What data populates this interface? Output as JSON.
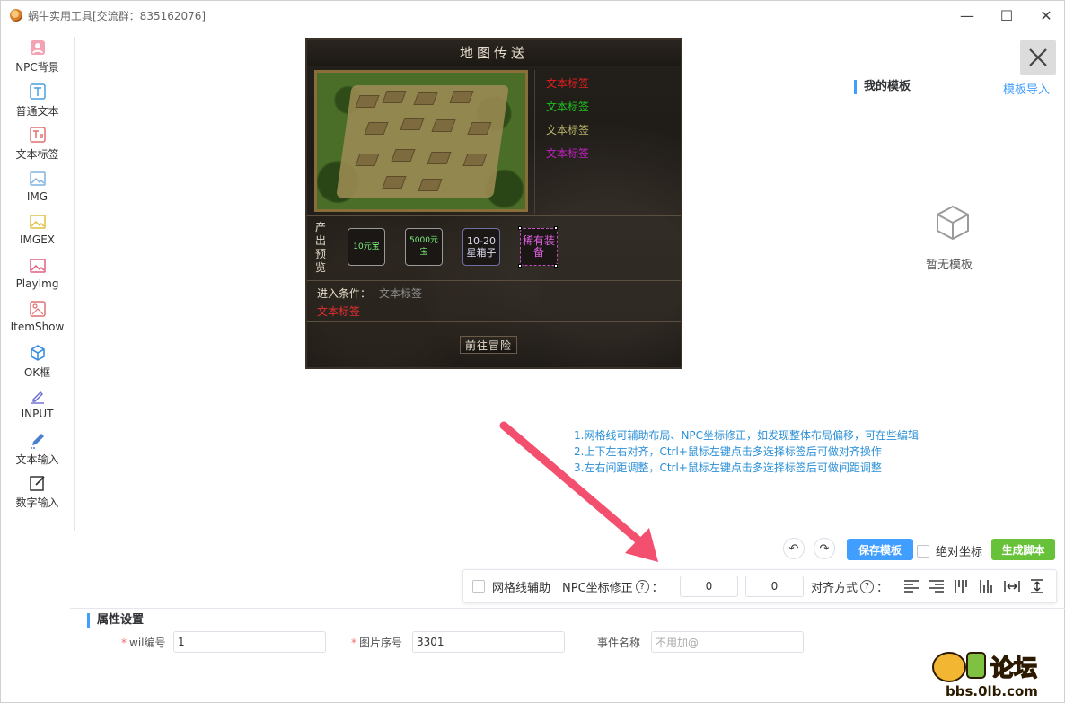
{
  "window": {
    "title": "蜗牛实用工具[交流群：835162076]",
    "controls": {
      "minimize": "—",
      "maximize": "☐",
      "close": "✕"
    }
  },
  "toolbar": {
    "items": [
      {
        "label": "NPC背景",
        "icon": "npc-icon"
      },
      {
        "label": "普通文本",
        "icon": "text-icon"
      },
      {
        "label": "文本标签",
        "icon": "text-tag-icon"
      },
      {
        "label": "IMG",
        "icon": "image-icon"
      },
      {
        "label": "IMGEX",
        "icon": "image-ex-icon"
      },
      {
        "label": "PlayImg",
        "icon": "play-image-icon"
      },
      {
        "label": "ItemShow",
        "icon": "item-show-icon"
      },
      {
        "label": "OK框",
        "icon": "box-icon"
      },
      {
        "label": "INPUT",
        "icon": "input-icon"
      },
      {
        "label": "文本输入",
        "icon": "pencil-icon"
      },
      {
        "label": "数字输入",
        "icon": "edit-icon"
      }
    ]
  },
  "game_panel": {
    "title": "地图传送",
    "text_labels": [
      {
        "text": "文本标签",
        "color": "#e02020"
      },
      {
        "text": "文本标签",
        "color": "#1fbf1f"
      },
      {
        "text": "文本标签",
        "color": "#b8b46a"
      },
      {
        "text": "文本标签",
        "color": "#c020c0"
      }
    ],
    "output_label": "产出预览",
    "items": [
      {
        "text": "10元宝"
      },
      {
        "text": "5000元宝"
      },
      {
        "text": "10-20星箱子"
      },
      {
        "text": "稀有装备"
      }
    ],
    "condition_label": "进入条件：",
    "condition_value": "文本标签",
    "condition_red": "文本标签",
    "go_button": "前往冒险"
  },
  "templates": {
    "title": "我的模板",
    "import_link": "模板导入",
    "empty_text": "暂无模板"
  },
  "tips": [
    "1.网格线可辅助布局、NPC坐标修正，如发现整体布局偏移，可在些编辑",
    "2.上下左右对齐，Ctrl+鼠标左键点击多选择标签后可做对齐操作",
    "3.左右间距调整，Ctrl+鼠标左键点击多选择标签后可做间距调整"
  ],
  "actions": {
    "save_template": "保存模板",
    "abs_coord": "绝对坐标",
    "generate_script": "生成脚本"
  },
  "gridbar": {
    "grid_helper": "网格线辅助",
    "npc_fix": "NPC坐标修正",
    "help": "?",
    "colon": "：",
    "x_value": "0",
    "y_value": "0",
    "align_label": "对齐方式"
  },
  "properties": {
    "title": "属性设置",
    "fields": [
      {
        "label": "wil编号",
        "required": true,
        "value": "1"
      },
      {
        "label": "图片序号",
        "required": true,
        "value": "3301"
      },
      {
        "label": "事件名称",
        "required": false,
        "placeholder": "不用加@"
      }
    ]
  },
  "watermark": {
    "brand": "论坛",
    "url": "bbs.0lb.com"
  }
}
